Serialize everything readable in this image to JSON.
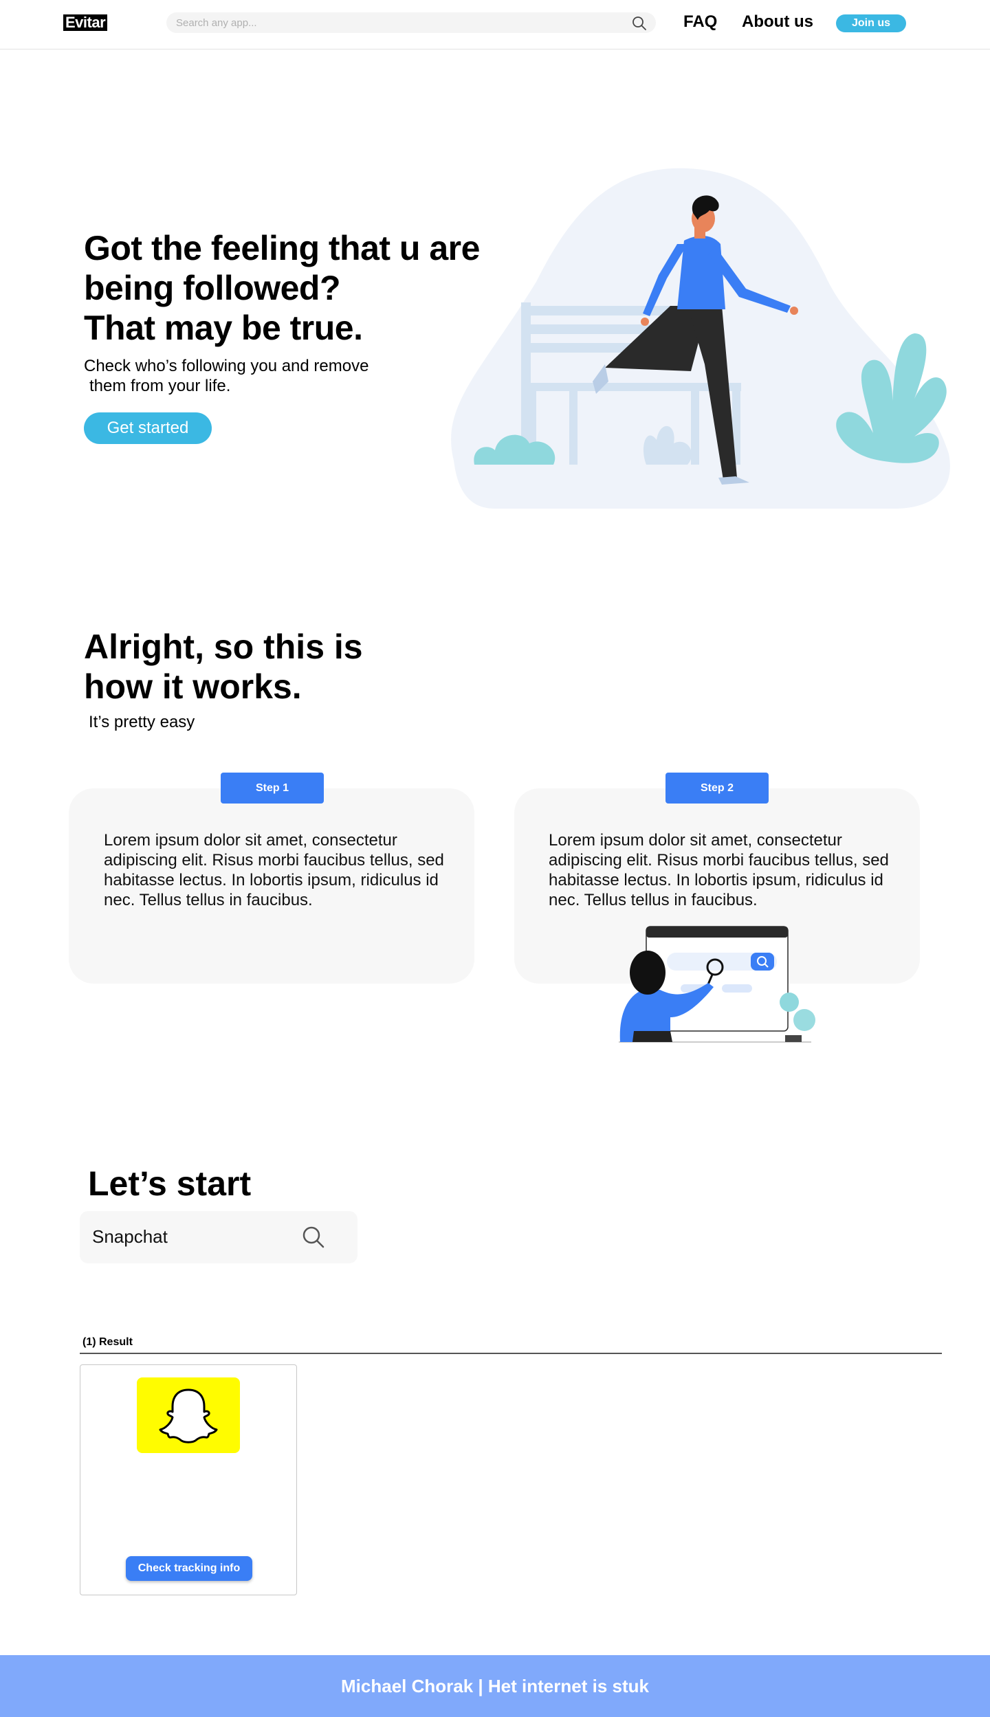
{
  "header": {
    "logo": "Evitar",
    "search_placeholder": "Search any app...",
    "nav_faq": "FAQ",
    "nav_about": "About us",
    "join_label": "Join us"
  },
  "hero": {
    "title_lines": [
      "Got the feeling that u are",
      "being followed?",
      "That may be true."
    ],
    "subtitle_lines": [
      "Check who’s following you and remove",
      "them from your life."
    ],
    "cta_label": "Get started"
  },
  "how": {
    "title_lines": [
      "Alright, so this is",
      "how it works."
    ],
    "subtitle": "It’s pretty easy",
    "steps": [
      {
        "label": "Step 1",
        "text": "Lorem ipsum dolor sit amet, consectetur adipiscing elit. Risus morbi faucibus tellus, sed habitasse lectus. In lobortis ipsum, ridiculus id nec. Tellus tellus in faucibus."
      },
      {
        "label": "Step 2",
        "text": "Lorem ipsum dolor sit amet, consectetur adipiscing elit. Risus morbi faucibus tellus, sed habitasse lectus. In lobortis ipsum, ridiculus id nec. Tellus tellus in faucibus."
      }
    ]
  },
  "start": {
    "title": "Let’s start",
    "search_value": "Snapchat"
  },
  "results": {
    "count_label": "(1) Result",
    "items": [
      {
        "app": "Snapchat",
        "logo_icon": "snapchat-ghost-icon",
        "button_label": "Check tracking info"
      }
    ]
  },
  "footer": {
    "text": "Michael Chorak | Het internet is stuk"
  },
  "colors": {
    "accent_cyan": "#3bb8e3",
    "accent_blue": "#3a7ef5",
    "footer_blue": "#80a9fb",
    "snap_yellow": "#fffc00"
  }
}
